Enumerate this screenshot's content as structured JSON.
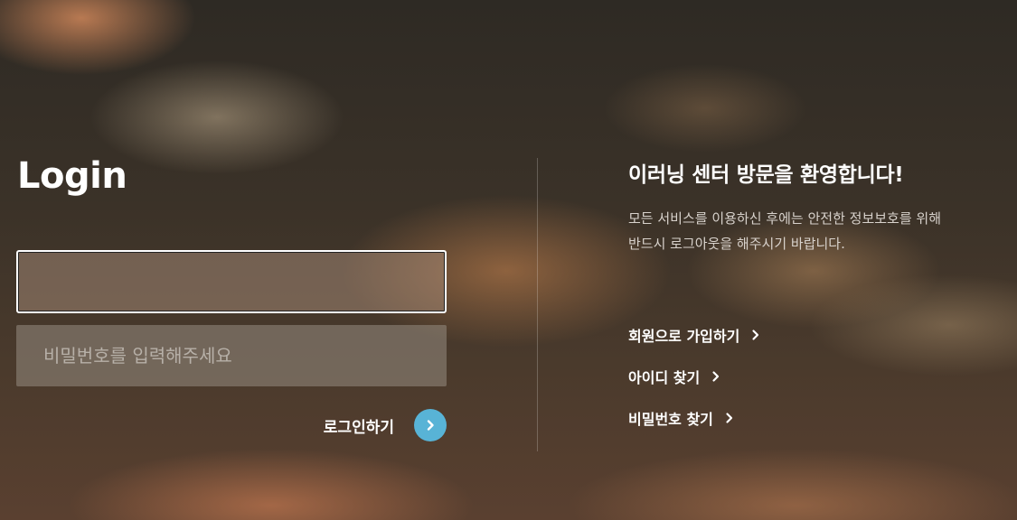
{
  "login": {
    "title": "Login",
    "id_field": {
      "value": "",
      "placeholder": ""
    },
    "password_field": {
      "placeholder": "비밀번호를 입력해주세요"
    },
    "submit_label": "로그인하기",
    "submit_icon": "chevron-right-icon",
    "accent_color": "#58b3d6"
  },
  "welcome": {
    "title": "이러닝 센터 방문을 환영합니다!",
    "desc_line1": "모든 서비스를 이용하신 후에는 안전한 정보보호를 위해",
    "desc_line2": "반드시 로그아웃을 해주시기 바랍니다."
  },
  "links": [
    {
      "label": "회원으로 가입하기",
      "icon": "chevron-right-icon"
    },
    {
      "label": "아이디 찾기",
      "icon": "chevron-right-icon"
    },
    {
      "label": "비밀번호 찾기",
      "icon": "chevron-right-icon"
    }
  ]
}
